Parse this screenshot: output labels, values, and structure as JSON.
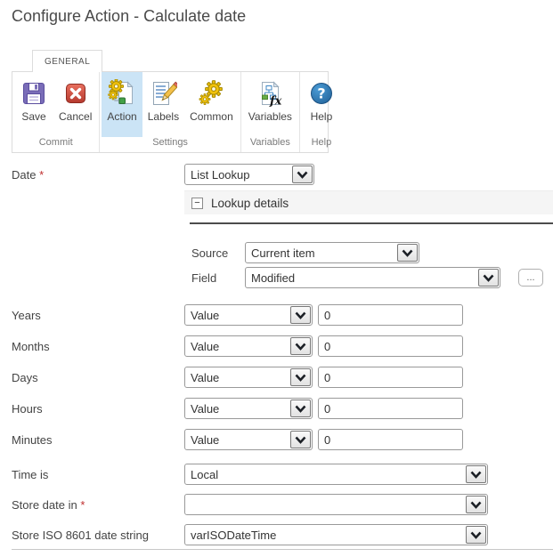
{
  "title": "Configure Action - Calculate date",
  "required_marker": "*",
  "ribbon": {
    "tab_label": "GENERAL",
    "groups": [
      {
        "label": "Commit",
        "buttons": [
          {
            "label": "Save"
          },
          {
            "label": "Cancel"
          }
        ]
      },
      {
        "label": "Settings",
        "buttons": [
          {
            "label": "Action",
            "selected": true
          },
          {
            "label": "Labels"
          },
          {
            "label": "Common"
          }
        ]
      },
      {
        "label": "Variables",
        "buttons": [
          {
            "label": "Variables"
          }
        ]
      },
      {
        "label": "Help",
        "buttons": [
          {
            "label": "Help"
          }
        ]
      }
    ]
  },
  "form": {
    "date": {
      "label": "Date",
      "required": true,
      "value": "List Lookup"
    },
    "lookup_details": {
      "header": "Lookup details",
      "collapse_glyph": "−"
    },
    "source": {
      "label": "Source",
      "value": "Current item"
    },
    "field": {
      "label": "Field",
      "value": "Modified",
      "browse_label": "..."
    },
    "offsets": [
      {
        "label": "Years",
        "mode": "Value",
        "value": "0"
      },
      {
        "label": "Months",
        "mode": "Value",
        "value": "0"
      },
      {
        "label": "Days",
        "mode": "Value",
        "value": "0"
      },
      {
        "label": "Hours",
        "mode": "Value",
        "value": "0"
      },
      {
        "label": "Minutes",
        "mode": "Value",
        "value": "0"
      }
    ],
    "time_is": {
      "label": "Time is",
      "value": "Local"
    },
    "store_date_in": {
      "label": "Store date in",
      "required": true,
      "value": ""
    },
    "store_iso": {
      "label": "Store ISO 8601 date string",
      "value": "varISODateTime"
    }
  },
  "colors": {
    "selected_button_bg": "#cbe4f6",
    "band_bg": "#f5f5f5",
    "required_red": "#bf2e2e",
    "gear_yellow": "#f2c20a",
    "save_purple": "#7a6db8",
    "cancel_red": "#c9473c",
    "help_blue": "#2e76b5",
    "dark_divider": "#4c4c4c"
  }
}
